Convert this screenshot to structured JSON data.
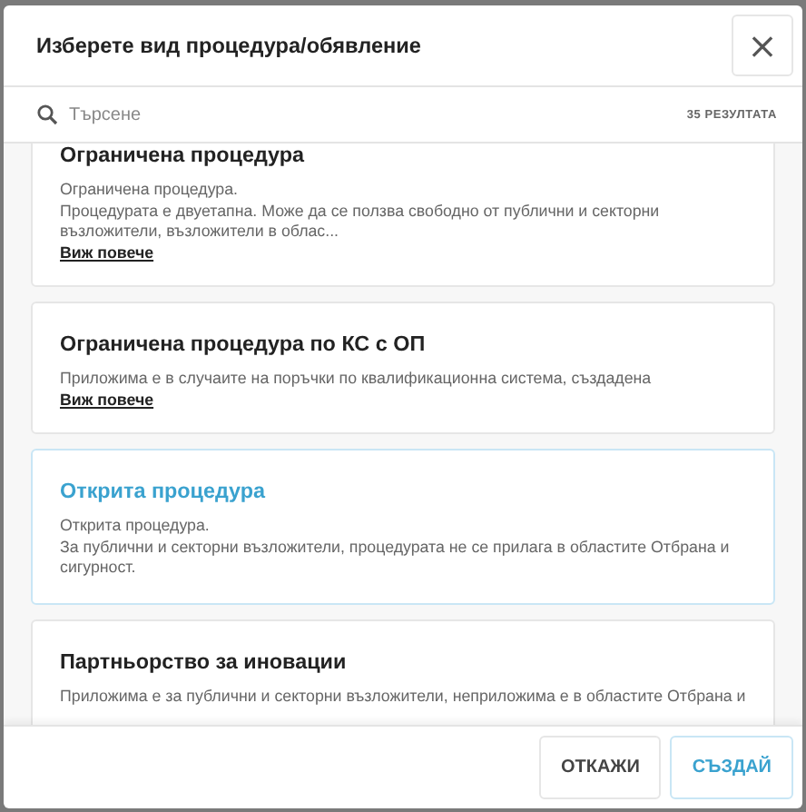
{
  "dialog": {
    "title": "Изберете вид процедура/обявление",
    "close": "×"
  },
  "search": {
    "placeholder": "Търсене",
    "results": "35 РЕЗУЛТАТА"
  },
  "items": [
    {
      "title": "Ограничена процедура",
      "description": "Ограничена процедура.\nПроцедурата е двуетапна. Може да се ползва свободно от публични и секторни възложители, възложители в облас...",
      "link": "Виж повече",
      "selected": false
    },
    {
      "title": "Ограничена процедура по КС с ОП",
      "description": "Приложима е в случаите на поръчки по квалификационна система, създадена",
      "link": "Виж повече",
      "selected": false
    },
    {
      "title": "Открита процедура",
      "description": "Открита процедура.\nЗа публични и секторни възложители, процедурата не се прилага в областите Отбрана и сигурност.",
      "selected": true
    },
    {
      "title": "Партньорство за иновации",
      "description": "Приложима е за публични и секторни възложители, неприложима е в областите Отбрана и",
      "selected": false
    }
  ],
  "buttons": [
    {
      "label": "ОТКАЖИ",
      "kind": "secondary"
    },
    {
      "label": "СЪЗДАЙ",
      "kind": "primary"
    }
  ]
}
